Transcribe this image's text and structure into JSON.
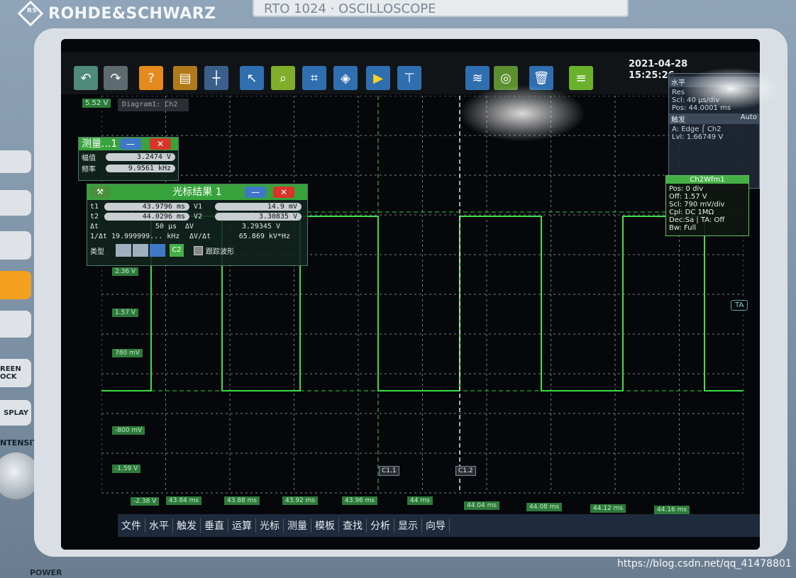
{
  "instrument": {
    "brand": "ROHDE&SCHWARZ",
    "brand_mark": "RS",
    "model": "RTO 1024 · OSCILLOSCOPE",
    "power_label": "POWER",
    "side_buttons": [
      "REEN OCK",
      "SPLAY"
    ],
    "side_label": "NTENSITY"
  },
  "toolbar": {
    "date": "2021-04-28",
    "time": "15:25:26"
  },
  "plot": {
    "ref_level": "5.52 V",
    "diagram_tab": "Diagram1: Ch2",
    "y_labels": [
      "2.36 V",
      "1.57 V",
      "780 mV",
      "-800 mV",
      "-1.59 V",
      "-2.38 V"
    ],
    "x_labels": [
      "43.84 ms",
      "43.88 ms",
      "43.92 ms",
      "43.96 ms",
      "44 ms",
      "44.04 ms",
      "44.08 ms",
      "44.12 ms",
      "44.16 ms"
    ],
    "cursor_labels": [
      "C1.1",
      "C1.2"
    ],
    "trigger_marker": "TA",
    "trace_color": "#3fe04a"
  },
  "measure_panel": {
    "title": "测量...1",
    "rows": [
      {
        "label": "幅值",
        "value": "3.2474 V"
      },
      {
        "label": "频率",
        "value": "9.9561 kHz"
      }
    ]
  },
  "cursor_panel": {
    "title": "光标结果 1",
    "rows": [
      {
        "l1": "t1",
        "v1": "43.9796 ms",
        "l2": "V1",
        "v2": "14.9 mV"
      },
      {
        "l1": "t2",
        "v1": "44.0296 ms",
        "l2": "V2",
        "v2": "3.30835 V"
      },
      {
        "l1": "Δt",
        "v1": "50 μs",
        "l2": "ΔV",
        "v2": "3.29345 V"
      },
      {
        "l1": "1/Δt",
        "v1": "19.999999... kHz",
        "l2": "ΔV/Δt",
        "v2": "65.869 kV*Hz"
      }
    ],
    "type_label": "类型",
    "source": "C2",
    "track_label": "跟踪波形"
  },
  "horizontal_panel": {
    "title": "水平",
    "res": "Res",
    "scale": "Scl: 40 μs/div",
    "position": "Pos: 44.0001 ms",
    "trigger_title": "触发",
    "trigger_mode": "Auto",
    "trigger_source": "A:    Edge  ⌠  Ch2",
    "trigger_level": "Lvl:  1.66749 V"
  },
  "waveform_panel": {
    "title": "Ch2Wfm1",
    "lines": [
      "Pos: 0 div",
      "Off: 1.57 V",
      "Scl: 790 mV/div",
      "Cpl: DC 1MΩ",
      "Dec:Sa | TA: Off",
      "Bw: Full"
    ]
  },
  "menu": [
    "文件",
    "水平",
    "触发",
    "垂直",
    "运算",
    "光标",
    "测量",
    "模板",
    "查找",
    "分析",
    "显示",
    "向导"
  ],
  "watermark": "https://blog.csdn.net/qq_41478801"
}
